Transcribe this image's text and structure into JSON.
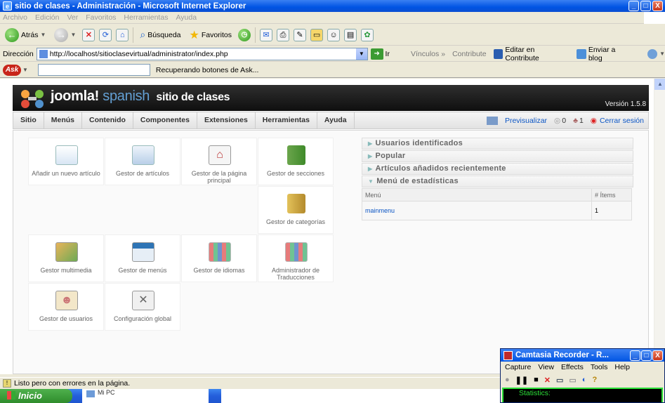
{
  "window": {
    "title": "sitio de clases - Administración - Microsoft Internet Explorer",
    "min_label": "_",
    "max_label": "□",
    "close_label": "X"
  },
  "ie_menu": [
    "Archivo",
    "Edición",
    "Ver",
    "Favoritos",
    "Herramientas",
    "Ayuda"
  ],
  "toolbar": {
    "back_label": "Atrás",
    "search_label": "Búsqueda",
    "favorites_label": "Favoritos"
  },
  "address": {
    "label": "Dirección",
    "url": "http://localhost/sitioclasevirtual/administrator/index.php",
    "go_label": "Ir",
    "links_label": "Vínculos",
    "contribute_label": "Contribute",
    "edit_contribute_label": "Editar en Contribute",
    "send_blog_label": "Enviar a blog"
  },
  "askbar": {
    "logo": "Ask",
    "status": "Recuperando botones de Ask..."
  },
  "joomla": {
    "brand": "joomla!",
    "brand_sub": "spanish",
    "site_name": "sitio de clases",
    "version": "Versión 1.5.8",
    "menu": [
      "Sitio",
      "Menús",
      "Contenido",
      "Componentes",
      "Extensiones",
      "Herramientas",
      "Ayuda"
    ],
    "preview_label": "Previsualizar",
    "messages_count": "0",
    "users_count": "1",
    "logout_label": "Cerrar sesión"
  },
  "cpanel": [
    {
      "label": "Añadir un nuevo artículo",
      "icon": "add-article-icon"
    },
    {
      "label": "Gestor de artículos",
      "icon": "article-manager-icon"
    },
    {
      "label": "Gestor de la página principal",
      "icon": "frontpage-manager-icon"
    },
    {
      "label": "Gestor de secciones",
      "icon": "section-manager-icon"
    },
    {
      "label": "Gestor de categorías",
      "icon": "category-manager-icon"
    },
    {
      "label": "Gestor multimedia",
      "icon": "media-manager-icon"
    },
    {
      "label": "Gestor de menús",
      "icon": "menu-manager-icon"
    },
    {
      "label": "Gestor de idiomas",
      "icon": "language-manager-icon"
    },
    {
      "label": "Administrador de Traducciones",
      "icon": "translation-admin-icon"
    },
    {
      "label": "Gestor de usuarios",
      "icon": "user-manager-icon"
    },
    {
      "label": "Configuración global",
      "icon": "global-config-icon"
    }
  ],
  "panels": {
    "logged_users": "Usuarios identificados",
    "popular": "Popular",
    "recent": "Artículos añadidos recientemente",
    "stats": "Menú de estadísticas",
    "stats_col_menu": "Menú",
    "stats_col_items": "# Ítems",
    "stats_rows": [
      {
        "menu": "mainmenu",
        "items": "1"
      }
    ]
  },
  "status": {
    "text": "Listo pero con errores en la página."
  },
  "taskbar": {
    "start_label": "Inicio",
    "item_label": "Mi PC"
  },
  "camtasia": {
    "title": "Camtasia Recorder - R...",
    "menu": [
      "Capture",
      "View",
      "Effects",
      "Tools",
      "Help"
    ],
    "stats_label": "Statistics:"
  },
  "colors": {
    "xp_blue": "#0054E3",
    "joomla_dark": "#1A1A1A",
    "link_blue": "#0B55C4",
    "camtasia_green": "#2BE038"
  }
}
